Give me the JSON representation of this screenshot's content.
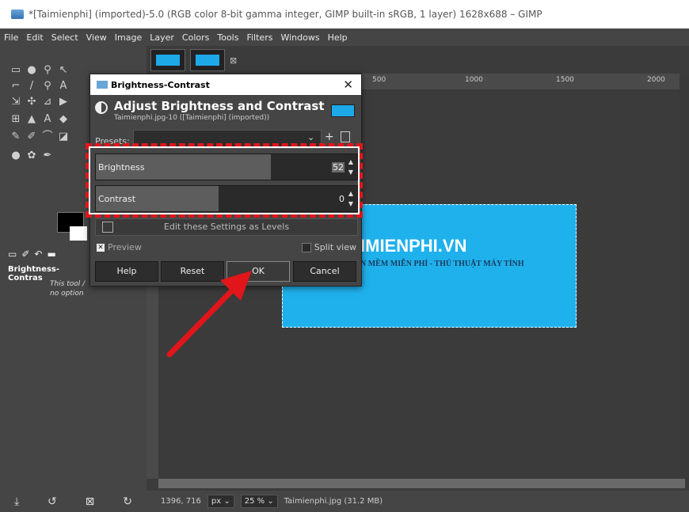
{
  "window": {
    "title": "*[Taimienphi] (imported)-5.0 (RGB color 8-bit gamma integer, GIMP built-in sRGB, 1 layer) 1628x688 – GIMP"
  },
  "menu": [
    "File",
    "Edit",
    "Select",
    "View",
    "Image",
    "Layer",
    "Colors",
    "Tools",
    "Filters",
    "Windows",
    "Help"
  ],
  "toolbox": {
    "tool_options_title": "Brightness-Contras",
    "tool_options_text_1": "This tool /",
    "tool_options_text_2": "no option"
  },
  "ruler": {
    "ticks": [
      "500",
      "1000",
      "1500",
      "2000"
    ]
  },
  "image": {
    "logo_text": "IMIENPHI.VN",
    "subtitle": "N MỀM MIỄN PHÍ - THỦ THUẬT MÁY TÍNH",
    "bg_color": "#1fb1ec"
  },
  "statusbar": {
    "coords": "1396, 716",
    "unit": "px",
    "zoom": "25 %",
    "file_info": "Taimienphi.jpg (31.2 MB)"
  },
  "dialog": {
    "title": "Brightness-Contrast",
    "heading": "Adjust Brightness and Contrast",
    "subheading": "Taimienphi.jpg-10 ([Taimienphi] (imported))",
    "presets_label": "Presets:",
    "brightness_label": "Brightness",
    "brightness_value": "52",
    "brightness_fraction": 0.67,
    "contrast_label": "Contrast",
    "contrast_value": "0",
    "contrast_fraction": 0.47,
    "levels_button": "Edit these Settings as Levels",
    "preview_label": "Preview",
    "split_view_label": "Split view",
    "buttons": {
      "help": "Help",
      "reset": "Reset",
      "ok": "OK",
      "cancel": "Cancel"
    }
  },
  "annotation": {
    "highlight_color": "#e0161b",
    "arrow_color": "#e0161b"
  }
}
